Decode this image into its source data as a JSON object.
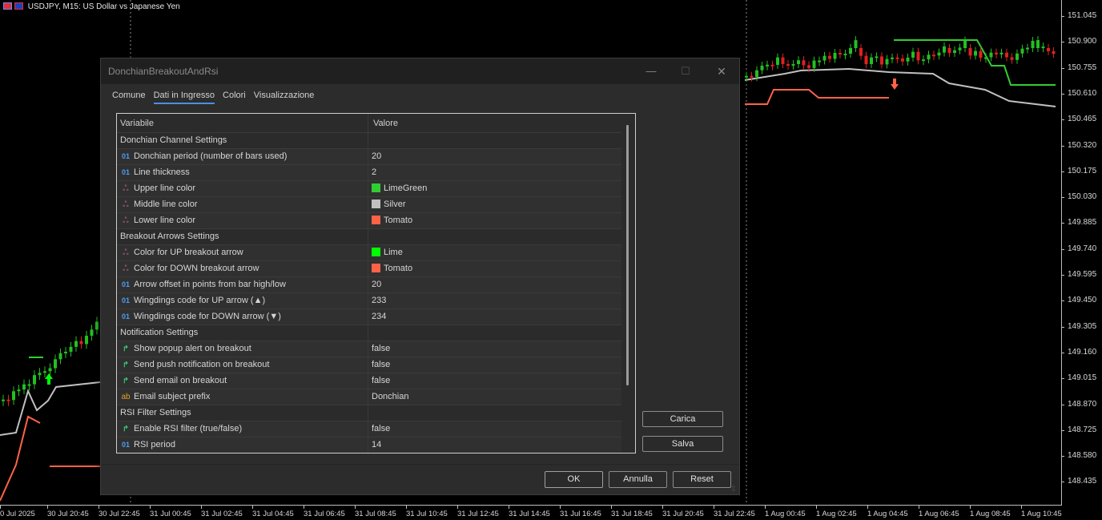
{
  "chart": {
    "symbol_title": "USDJPY, M15:  US Dollar vs Japanese Yen",
    "price_labels": [
      "151.045",
      "150.900",
      "150.755",
      "150.610",
      "150.465",
      "150.320",
      "150.175",
      "150.030",
      "149.885",
      "149.740",
      "149.595",
      "149.450",
      "149.305",
      "149.160",
      "149.015",
      "148.870",
      "148.725",
      "148.580",
      "148.435"
    ],
    "time_labels": [
      "0 Jul 2025",
      "30 Jul 20:45",
      "30 Jul 22:45",
      "31 Jul 00:45",
      "31 Jul 02:45",
      "31 Jul 04:45",
      "31 Jul 06:45",
      "31 Jul 08:45",
      "31 Jul 10:45",
      "31 Jul 12:45",
      "31 Jul 14:45",
      "31 Jul 16:45",
      "31 Jul 18:45",
      "31 Jul 20:45",
      "31 Jul 22:45",
      "1 Aug 00:45",
      "1 Aug 02:45",
      "1 Aug 04:45",
      "1 Aug 06:45",
      "1 Aug 08:45",
      "1 Aug 10:45"
    ],
    "colors": {
      "upper": "#32CD32",
      "middle": "#C0C0C0",
      "lower": "#FF6347",
      "bull": "#22C022",
      "bear": "#E02020"
    }
  },
  "dialog": {
    "title": "DonchianBreakoutAndRsi",
    "tabs": [
      "Comune",
      "Dati in Ingresso",
      "Colori",
      "Visualizzazione"
    ],
    "active_tab": 1,
    "columns": {
      "variable": "Variabile",
      "value": "Valore"
    },
    "rows": [
      {
        "type": "section",
        "name": "Donchian Channel Settings"
      },
      {
        "type": "int",
        "name": "Donchian period (number of bars used)",
        "value": "20"
      },
      {
        "type": "int",
        "name": "Line thickness",
        "value": "2"
      },
      {
        "type": "color",
        "name": "Upper line color",
        "value": "LimeGreen",
        "swatch": "#32CD32"
      },
      {
        "type": "color",
        "name": "Middle line color",
        "value": "Silver",
        "swatch": "#C0C0C0"
      },
      {
        "type": "color",
        "name": "Lower line color",
        "value": "Tomato",
        "swatch": "#FF6347"
      },
      {
        "type": "section",
        "name": "Breakout Arrows Settings"
      },
      {
        "type": "color",
        "name": "Color for UP breakout arrow",
        "value": "Lime",
        "swatch": "#00FF00"
      },
      {
        "type": "color",
        "name": "Color for DOWN breakout arrow",
        "value": "Tomato",
        "swatch": "#FF6347"
      },
      {
        "type": "int",
        "name": "Arrow offset in points from bar high/low",
        "value": "20"
      },
      {
        "type": "int",
        "name": "Wingdings code for UP arrow (▲)",
        "value": "233"
      },
      {
        "type": "int",
        "name": "Wingdings code for DOWN arrow (▼)",
        "value": "234"
      },
      {
        "type": "section",
        "name": "Notification Settings"
      },
      {
        "type": "bool",
        "name": "Show popup alert on breakout",
        "value": "false"
      },
      {
        "type": "bool",
        "name": "Send push notification on breakout",
        "value": "false"
      },
      {
        "type": "bool",
        "name": "Send email on breakout",
        "value": "false"
      },
      {
        "type": "string",
        "name": "Email subject prefix",
        "value": "Donchian"
      },
      {
        "type": "section",
        "name": "RSI Filter Settings"
      },
      {
        "type": "bool",
        "name": "Enable RSI filter (true/false)",
        "value": "false"
      },
      {
        "type": "int",
        "name": "RSI period",
        "value": "14"
      }
    ],
    "type_icons": {
      "int": "01",
      "color": "ஃ",
      "bool": "↱",
      "string": "ab"
    },
    "side_buttons": {
      "load": "Carica",
      "save": "Salva"
    },
    "footer": {
      "ok": "OK",
      "cancel": "Annulla",
      "reset": "Reset"
    },
    "window_controls": {
      "minimize": "—",
      "maximize": "☐",
      "close": "✕"
    }
  }
}
